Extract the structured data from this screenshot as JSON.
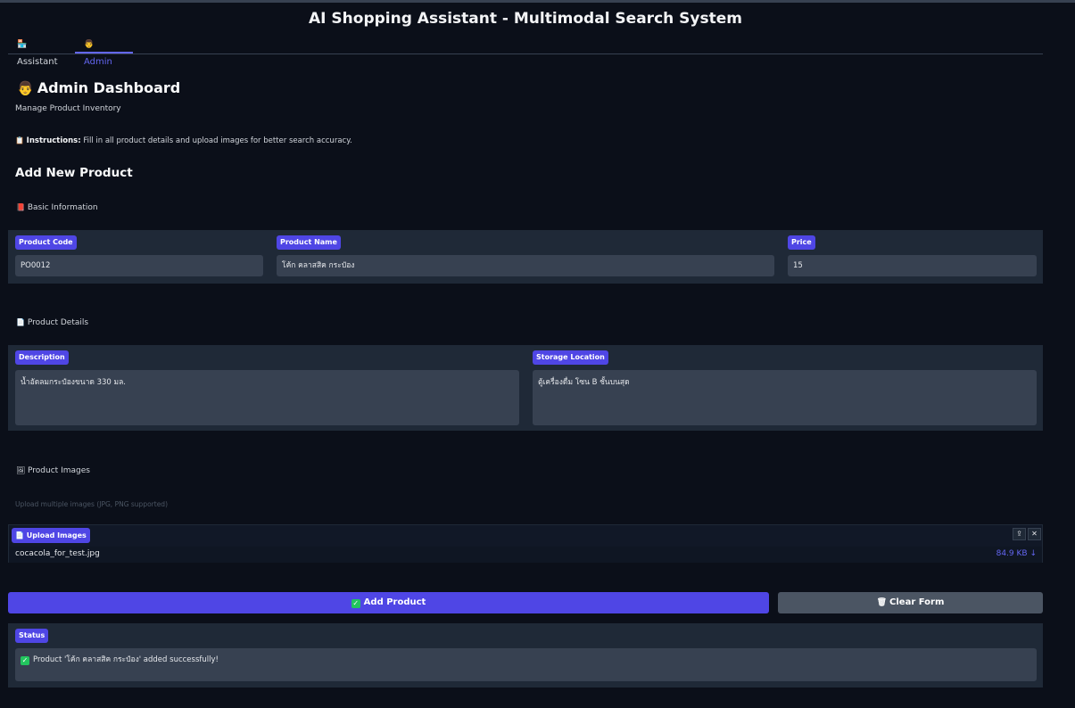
{
  "app": {
    "title": "AI Shopping Assistant - Multimodal Search System"
  },
  "tabs": [
    {
      "label": "Assistant",
      "icon": "storefront-icon",
      "active": false
    },
    {
      "label": "Admin",
      "icon": "person-icon",
      "active": true
    }
  ],
  "dashboard": {
    "title": "Admin Dashboard",
    "subtitle": "Manage Product Inventory",
    "instructions_label": "Instructions:",
    "instructions_text": "Fill in all product details and upload images for better search accuracy.",
    "add_heading": "Add New Product"
  },
  "basic": {
    "section_label": "Basic Information",
    "fields": {
      "code": {
        "label": "Product Code",
        "value": "PO0012"
      },
      "name": {
        "label": "Product Name",
        "value": "โค้ก คลาสสิค กระป๋อง"
      },
      "price": {
        "label": "Price",
        "value": "15"
      }
    }
  },
  "details": {
    "section_label": "Product Details",
    "fields": {
      "description": {
        "label": "Description",
        "value": "น้ำอัดลมกระป๋องขนาด 330 มล."
      },
      "location": {
        "label": "Storage Location",
        "value": "ตู้เครื่องดื่ม โซน B ชั้นบนสุด"
      }
    }
  },
  "images": {
    "section_label": "Product Images",
    "hint": "Upload multiple images (JPG, PNG supported)",
    "upload_label": "Upload Images",
    "file": {
      "name": "cocacola_for_test.jpg",
      "size": "84.9 KB ↓"
    }
  },
  "actions": {
    "add_label": "Add Product",
    "clear_label": "Clear Form"
  },
  "status": {
    "label": "Status",
    "message": "Product 'โค้ก คลาสสิค กระป๋อง' added successfully!"
  },
  "colors": {
    "background": "#0b0f19",
    "panel": "#1f2937",
    "accent": "#4f46e5",
    "input": "#374151"
  }
}
